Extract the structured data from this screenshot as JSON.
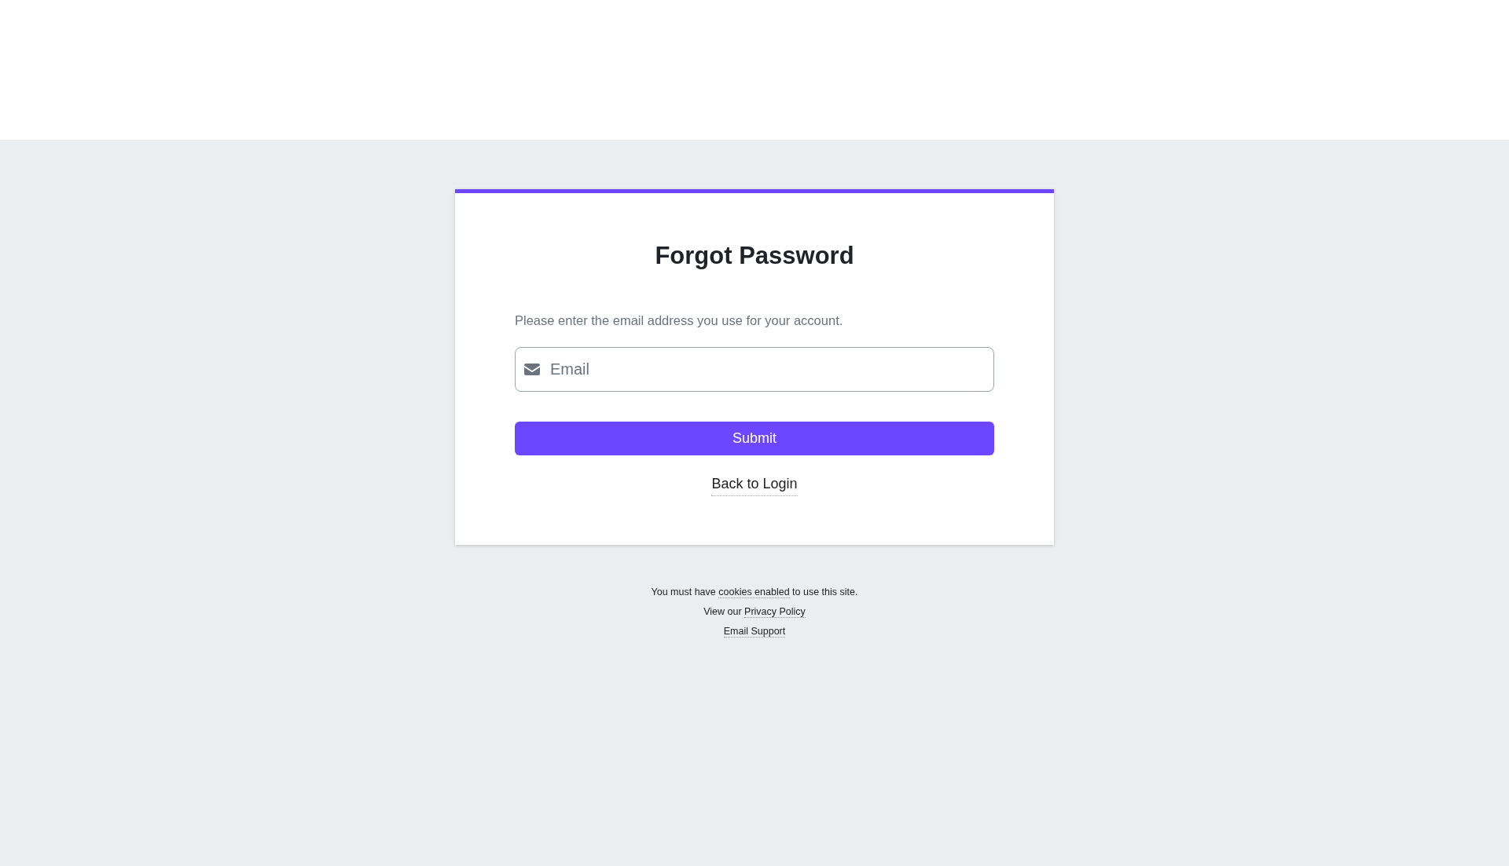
{
  "card": {
    "title": "Forgot Password",
    "instruction": "Please enter the email address you use for your account.",
    "email_field": {
      "placeholder": "Email"
    },
    "submit_button": "Submit",
    "back_link": "Back to Login"
  },
  "footer": [
    {
      "before": "You must have ",
      "link": "cookies enabled",
      "after": " to use this site."
    },
    {
      "before": "View our ",
      "link": "Privacy Policy"
    },
    {
      "link": "Email Support"
    }
  ]
}
